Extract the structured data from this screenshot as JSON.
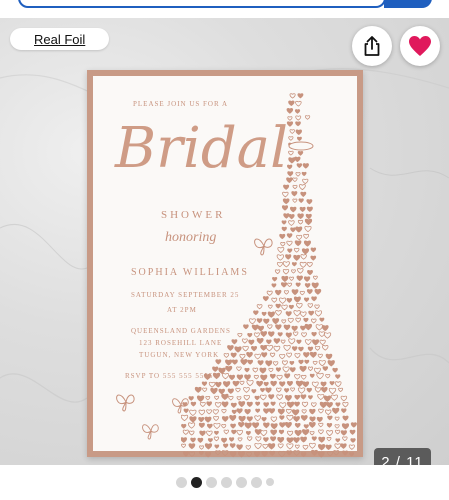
{
  "badge": {
    "label": "Real Foil"
  },
  "actions": {
    "share_icon": "share-icon",
    "favorite_icon": "heart-icon",
    "favorite_color": "#e0195c"
  },
  "invitation": {
    "please": "PLEASE JOIN US FOR A",
    "bridal": "Bridal",
    "shower": "SHOWER",
    "honoring": "honoring",
    "name": "SOPHIA WILLIAMS",
    "date": "SATURDAY SEPTEMBER 25",
    "time": "AT 2PM",
    "venue": "QUEENSLAND GARDENS",
    "address1": "123 ROSEHILL LANE",
    "address2": "TUGUN, NEW YORK",
    "rsvp": "RSVP TO 555 555 5555",
    "foil_color": "#c7927d"
  },
  "gallery": {
    "counter": "2 / 11",
    "current": 2,
    "total": 11,
    "dots_visible": 7
  }
}
